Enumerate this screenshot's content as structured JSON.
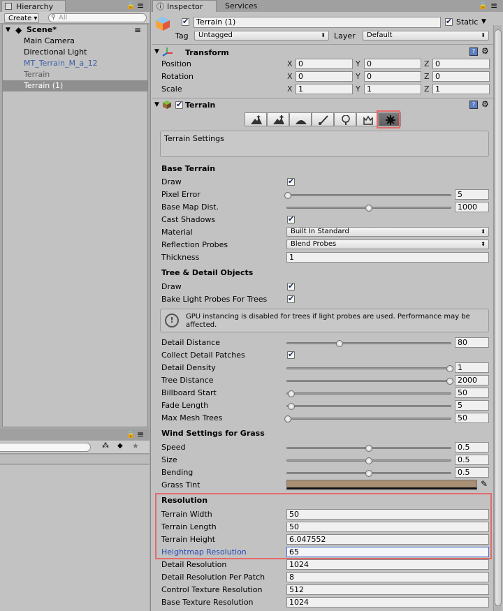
{
  "hierarchy": {
    "tab_label": "Hierarchy",
    "create_label": "Create ▾",
    "search_placeholder": "All",
    "scene_name": "Scene*",
    "items": [
      {
        "label": "Main Camera",
        "style": "normal"
      },
      {
        "label": "Directional Light",
        "style": "normal"
      },
      {
        "label": "MT_Terrain_M_a_12",
        "style": "prefab"
      },
      {
        "label": "Terrain",
        "style": "grey"
      },
      {
        "label": "Terrain (1)",
        "style": "selected"
      }
    ]
  },
  "inspector": {
    "tab_label": "Inspector",
    "services_label": "Services",
    "object_name": "Terrain (1)",
    "static_label": "Static",
    "tag_label": "Tag",
    "tag_value": "Untagged",
    "layer_label": "Layer",
    "layer_value": "Default",
    "transform": {
      "title": "Transform",
      "rows": [
        {
          "label": "Position",
          "x": "0",
          "y": "0",
          "z": "0"
        },
        {
          "label": "Rotation",
          "x": "0",
          "y": "0",
          "z": "0"
        },
        {
          "label": "Scale",
          "x": "1",
          "y": "1",
          "z": "1"
        }
      ],
      "axis_x": "X",
      "axis_y": "Y",
      "axis_z": "Z"
    },
    "terrain": {
      "title": "Terrain",
      "settings_caption": "Terrain Settings",
      "base_terrain_header": "Base Terrain",
      "draw_label": "Draw",
      "pixel_error_label": "Pixel Error",
      "pixel_error_value": "5",
      "pixel_error_fraction": 0.0,
      "base_map_dist_label": "Base Map Dist.",
      "base_map_dist_value": "1000",
      "base_map_dist_fraction": 0.5,
      "cast_shadows_label": "Cast Shadows",
      "material_label": "Material",
      "material_value": "Built In Standard",
      "reflection_label": "Reflection Probes",
      "reflection_value": "Blend Probes",
      "thickness_label": "Thickness",
      "thickness_value": "1",
      "tree_header": "Tree & Detail Objects",
      "tree_draw_label": "Draw",
      "bake_label": "Bake Light Probes For Trees",
      "gpu_warning": "GPU instancing is disabled for trees if light probes are used. Performance may be affected.",
      "detail_distance_label": "Detail Distance",
      "detail_distance_value": "80",
      "detail_distance_fraction": 0.32,
      "collect_patches_label": "Collect Detail Patches",
      "detail_density_label": "Detail Density",
      "detail_density_value": "1",
      "detail_density_fraction": 1.0,
      "tree_distance_label": "Tree Distance",
      "tree_distance_value": "2000",
      "tree_distance_fraction": 1.0,
      "billboard_label": "Billboard Start",
      "billboard_value": "50",
      "billboard_fraction": 0.02,
      "fade_label": "Fade Length",
      "fade_value": "5",
      "fade_fraction": 0.02,
      "max_mesh_label": "Max Mesh Trees",
      "max_mesh_value": "50",
      "max_mesh_fraction": 0.0,
      "wind_header": "Wind Settings for Grass",
      "speed_label": "Speed",
      "speed_value": "0.5",
      "speed_fraction": 0.5,
      "size_label": "Size",
      "size_value": "0.5",
      "size_fraction": 0.5,
      "bending_label": "Bending",
      "bending_value": "0.5",
      "bending_fraction": 0.5,
      "grass_tint_label": "Grass Tint",
      "grass_tint_color": "#a88e72",
      "resolution_header": "Resolution",
      "terrain_width_label": "Terrain Width",
      "terrain_width_value": "50",
      "terrain_length_label": "Terrain Length",
      "terrain_length_value": "50",
      "terrain_height_label": "Terrain Height",
      "terrain_height_value": "6.047552",
      "heightmap_label": "Heightmap Resolution",
      "heightmap_value": "65",
      "detail_res_label": "Detail Resolution",
      "detail_res_value": "1024",
      "detail_patch_label": "Detail Resolution Per Patch",
      "detail_patch_value": "8",
      "control_tex_label": "Control Texture Resolution",
      "control_tex_value": "512",
      "base_tex_label": "Base Texture Resolution",
      "base_tex_value": "1024"
    },
    "tool_icons": [
      "raise-terrain-icon",
      "paint-height-icon",
      "smooth-height-icon",
      "paint-texture-icon",
      "place-trees-icon",
      "paint-details-icon",
      "terrain-settings-icon"
    ],
    "highlight_color": "#e46a6a"
  }
}
